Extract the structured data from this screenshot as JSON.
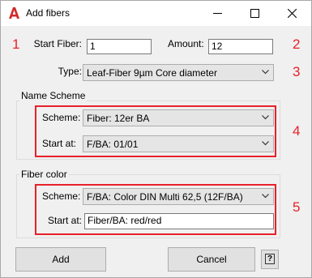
{
  "window": {
    "title": "Add fibers"
  },
  "icons": {
    "app": "autocad-a-icon",
    "minimize": "minimize-icon",
    "maximize": "maximize-icon",
    "close": "close-icon",
    "dropdown": "chevron-down-icon"
  },
  "colors": {
    "annotation": "#e8202a"
  },
  "start_fiber": {
    "label": "Start Fiber:",
    "value": "1"
  },
  "amount": {
    "label": "Amount:",
    "value": "12"
  },
  "type": {
    "label": "Type:",
    "value": "Leaf-Fiber 9µm Core diameter"
  },
  "name_scheme": {
    "title": "Name Scheme",
    "scheme_label": "Scheme:",
    "scheme_value": "Fiber: 12er BA",
    "start_label": "Start at:",
    "start_value": "F/BA: 01/01"
  },
  "fiber_color": {
    "title": "Fiber color",
    "scheme_label": "Scheme:",
    "scheme_value": "F/BA: Color DIN Multi 62,5  (12F/BA)",
    "start_label": "Start at:",
    "start_value": "Fiber/BA: red/red"
  },
  "buttons": {
    "add": "Add",
    "cancel": "Cancel",
    "help": "?"
  },
  "annotations": [
    "1",
    "2",
    "3",
    "4",
    "5"
  ]
}
